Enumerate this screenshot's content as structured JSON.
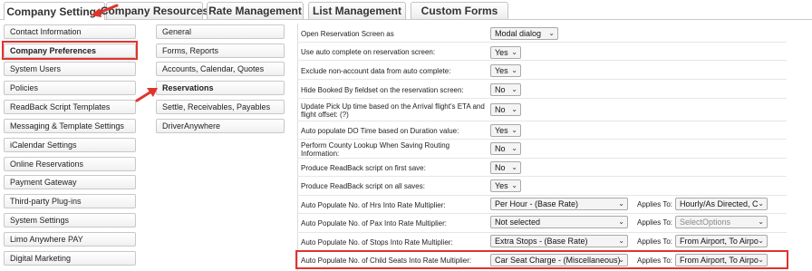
{
  "tabs": [
    {
      "label": "Company Settings",
      "active": true
    },
    {
      "label": "Company Resources",
      "active": false
    },
    {
      "label": "Rate Management",
      "active": false
    },
    {
      "label": "List Management",
      "active": false
    },
    {
      "label": "Custom Forms",
      "active": false
    }
  ],
  "sidebar": {
    "items": [
      {
        "label": "Contact Information"
      },
      {
        "label": "Company Preferences",
        "active": true
      },
      {
        "label": "System Users"
      },
      {
        "label": "Policies"
      },
      {
        "label": "ReadBack Script Templates"
      },
      {
        "label": "Messaging & Template Settings"
      },
      {
        "label": "iCalendar Settings"
      },
      {
        "label": "Online Reservations"
      },
      {
        "label": "Payment Gateway"
      },
      {
        "label": "Third-party Plug-ins"
      },
      {
        "label": "System Settings"
      },
      {
        "label": "Limo Anywhere PAY"
      },
      {
        "label": "Digital Marketing"
      }
    ]
  },
  "submenu": {
    "items": [
      {
        "label": "General"
      },
      {
        "label": "Forms, Reports"
      },
      {
        "label": "Accounts, Calendar, Quotes"
      },
      {
        "label": "Reservations",
        "active": true
      },
      {
        "label": "Settle, Receivables, Payables"
      },
      {
        "label": "DriverAnywhere"
      }
    ]
  },
  "settings": {
    "applies_to_label": "Applies To:",
    "rows": [
      {
        "label": "Open Reservation Screen as",
        "value": "Modal dialog"
      },
      {
        "label": "Use auto complete on reservation screen:",
        "value": "Yes"
      },
      {
        "label": "Exclude non-account data from auto complete:",
        "value": "Yes"
      },
      {
        "label": "Hide Booked By fieldset on the reservation screen:",
        "value": "No"
      },
      {
        "label": "Update Pick Up time based on the Arrival flight's ETA and flight offset: (?)",
        "value": "No"
      },
      {
        "label": "Auto populate DO Time based on Duration value:",
        "value": "Yes"
      },
      {
        "label": "Perform County Lookup When Saving Routing Information:",
        "value": "No"
      },
      {
        "label": "Produce ReadBack script on first save:",
        "value": "No"
      },
      {
        "label": "Produce ReadBack script on all saves:",
        "value": "Yes"
      },
      {
        "label": "Auto Populate No. of Hrs Into Rate Multiplier:",
        "value": "Per Hour - (Base Rate)",
        "applies": "Hourly/As Directed, C"
      },
      {
        "label": "Auto Populate No. of Pax Into Rate Multiplier:",
        "value": "Not selected",
        "applies": "SelectOptions"
      },
      {
        "label": "Auto Populate No. of Stops Into Rate Multiplier:",
        "value": "Extra Stops - (Base Rate)",
        "applies": "From Airport, To Airpo"
      },
      {
        "label": "Auto Populate No. of Child Seats Into Rate Multiplier:",
        "value": "Car Seat Charge - (Miscellaneous)",
        "applies": "From Airport, To Airpo"
      }
    ]
  },
  "colors": {
    "annotation": "#e0342c",
    "tab_border": "#c4c4c4"
  }
}
